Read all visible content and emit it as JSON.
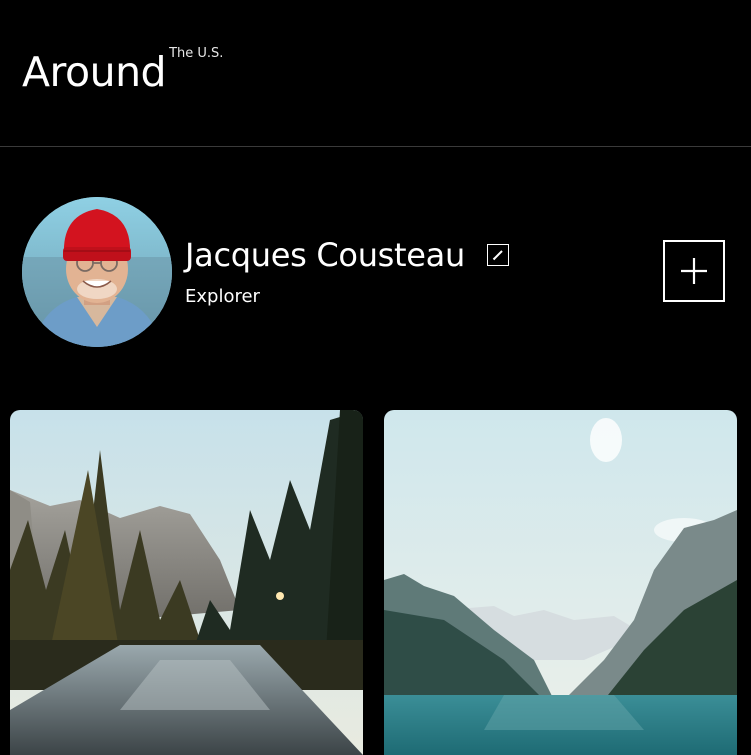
{
  "header": {
    "logo_main": "Around",
    "logo_sup": "The U.S."
  },
  "profile": {
    "name": "Jacques Cousteau",
    "about": "Explorer",
    "avatar_alt": "Jacques Cousteau wearing a red beanie"
  },
  "icons": {
    "edit": "pencil-icon",
    "add": "plus-icon"
  },
  "cards": [
    {
      "image": "Yosemite river with pine trees and granite cliffs"
    },
    {
      "image": "Mountain lake with reflections"
    }
  ],
  "colors": {
    "background": "#000000",
    "text": "#ffffff",
    "divider": "#3a3a3a",
    "beanie": "#d3131f"
  }
}
